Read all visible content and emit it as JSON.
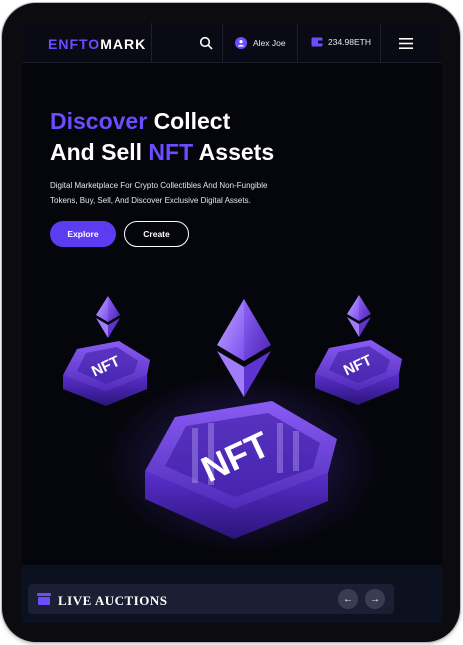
{
  "header": {
    "logo_part1": "ENFTO",
    "logo_part2": "MARK",
    "user_name": "Alex Joe",
    "wallet_balance": "234.98ETH",
    "icons": [
      "search-icon",
      "user-icon",
      "wallet-icon",
      "menu-icon"
    ]
  },
  "hero": {
    "title_highlight_1": "Discover",
    "title_text_1": "Collect",
    "title_text_2a": "And Sell",
    "title_highlight_2": "NFT",
    "title_text_2b": "Assets",
    "desc_line1": "Digital Marketplace For Crypto Collectibles And Non-Fungible",
    "desc_line2": "Tokens, Buy, Sell, And Discover Exclusive Digital Assets.",
    "explore_label": "Explore",
    "create_label": "Create",
    "art_tag": "NFT"
  },
  "auctions": {
    "label": "LIVE AUCTIONS",
    "prev_arrow": "←",
    "next_arrow": "→"
  },
  "colors": {
    "accent": "#6b4dff",
    "background": "#05050c",
    "header": "#0a0a14",
    "bottom_section": "#0c1120"
  }
}
